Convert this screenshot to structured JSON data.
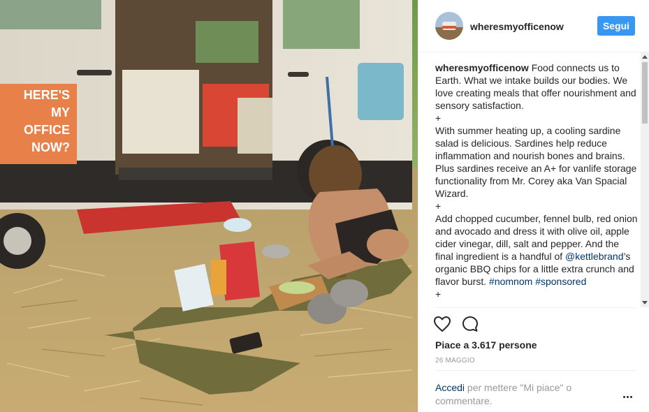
{
  "post": {
    "username": "wheresmyofficenow",
    "follow_label": "Segui",
    "van_sign": [
      "HERE'S",
      "MY",
      "OFFICE",
      "NOW?"
    ],
    "caption": {
      "user": "wheresmyofficenow",
      "lines": [
        "Food connects us to Earth. What we intake builds our bodies. We love creating meals that offer nourishment and sensory satisfaction.",
        "+",
        "With summer heating up, a cooling sardine salad is delicious. Sardines help reduce inflammation and nourish bones and brains. Plus sardines receive an A+ for vanlife storage functionality from Mr. Corey aka Van Spacial Wizard.",
        "+",
        "Add chopped cucumber, fennel bulb, red onion and avocado and dress it with olive oil, apple cider vinegar, dill, salt and pepper. And the final ingredient is a handful of",
        "+"
      ],
      "mention": "@kettlebrand",
      "after_mention": "’s organic BBQ chips for a little extra crunch and flavor burst.",
      "hashtags": [
        "#nomnom",
        "#sponsored"
      ]
    },
    "likes_text": "Piace a 3.617 persone",
    "date": "26 MAGGIO",
    "comment_login": "Accedi",
    "comment_rest": "per mettere \"Mi piace\" o commentare."
  },
  "icons": {
    "like": "heart-icon",
    "comment": "comment-bubble-icon",
    "more": "more-options-icon"
  },
  "colors": {
    "follow_bg": "#3897f0",
    "link": "#003569",
    "muted": "#999999",
    "text": "#262626"
  }
}
